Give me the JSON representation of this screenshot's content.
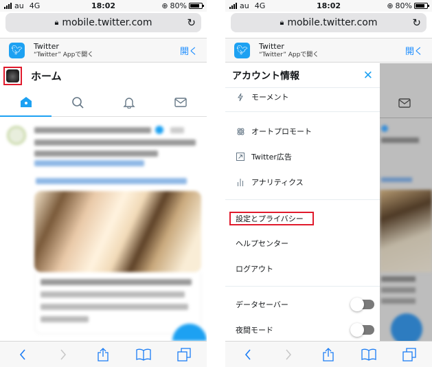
{
  "status_bar": {
    "carrier": "au",
    "network": "4G",
    "time": "18:02",
    "battery": "80%"
  },
  "browser": {
    "url": "mobile.twitter.com",
    "lock_icon": "lock-icon",
    "reload_icon": "reload-icon"
  },
  "app_banner": {
    "app_name": "Twitter",
    "subtitle": "“Twitter” Appで開く",
    "open_label": "開く"
  },
  "left_screen": {
    "header_title": "ホーム",
    "tabs": [
      {
        "name": "home",
        "icon": "home-icon",
        "active": true
      },
      {
        "name": "search",
        "icon": "search-icon",
        "active": false
      },
      {
        "name": "notifications",
        "icon": "bell-icon",
        "active": false
      },
      {
        "name": "messages",
        "icon": "mail-icon",
        "active": false
      }
    ]
  },
  "right_screen": {
    "drawer_title": "アカウント情報",
    "close_icon": "close-icon",
    "menu_items": [
      {
        "label": "モーメント",
        "icon": "lightning-icon"
      },
      {
        "label": "オートプロモート",
        "icon": "autopromote-icon"
      },
      {
        "label": "Twitter広告",
        "icon": "external-link-icon"
      },
      {
        "label": "アナリティクス",
        "icon": "analytics-icon"
      },
      {
        "label": "設定とプライバシー",
        "highlighted": true
      },
      {
        "label": "ヘルプセンター"
      },
      {
        "label": "ログアウト"
      }
    ],
    "toggles": [
      {
        "label": "データセーバー",
        "on": false
      },
      {
        "label": "夜間モード",
        "on": false
      }
    ]
  },
  "safari_toolbar": {
    "buttons": [
      {
        "name": "back",
        "icon": "chevron-left-icon",
        "enabled": true
      },
      {
        "name": "forward",
        "icon": "chevron-right-icon",
        "enabled": false
      },
      {
        "name": "share",
        "icon": "share-icon",
        "enabled": true
      },
      {
        "name": "bookmarks",
        "icon": "book-icon",
        "enabled": true
      },
      {
        "name": "tabs",
        "icon": "tabs-icon",
        "enabled": true
      }
    ]
  },
  "colors": {
    "accent": "#1da1f2",
    "safari_blue": "#1a7cf5",
    "highlight_red": "#e0192b"
  }
}
